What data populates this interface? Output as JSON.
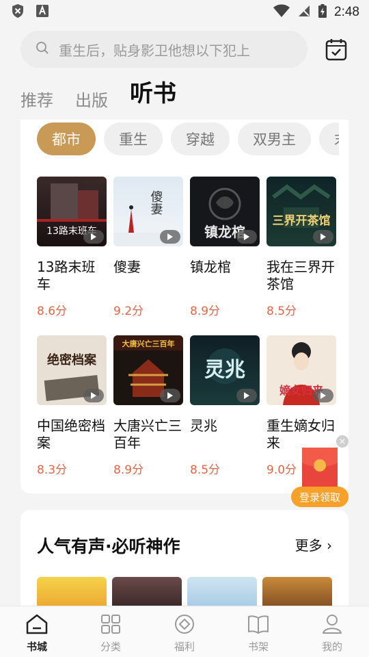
{
  "status_bar": {
    "time": "2:48"
  },
  "search": {
    "placeholder": "重生后，贴身影卫他想以下犯上"
  },
  "tabs": [
    {
      "label": "推荐",
      "active": false
    },
    {
      "label": "出版",
      "active": false
    },
    {
      "label": "听书",
      "active": true
    }
  ],
  "categories": [
    "都市",
    "重生",
    "穿越",
    "双男主",
    "末"
  ],
  "selected_category": "都市",
  "books": [
    {
      "title": "13路末班车",
      "score": "8.6分",
      "cover_text": "13路末班车"
    },
    {
      "title": "傻妻",
      "score": "9.2分",
      "cover_text": "傻妻"
    },
    {
      "title": "镇龙棺",
      "score": "8.9分",
      "cover_text": "镇龙棺"
    },
    {
      "title": "我在三界开茶馆",
      "score": "8.5分",
      "cover_text": "三界开茶馆"
    },
    {
      "title": "中国绝密档案",
      "score": "8.3分",
      "cover_text": "绝密档案"
    },
    {
      "title": "大唐兴亡三百年",
      "score": "8.9分",
      "cover_text": "大唐兴亡三百年"
    },
    {
      "title": "灵兆",
      "score": "8.5分",
      "cover_text": "灵兆"
    },
    {
      "title": "重生嫡女归来",
      "score": "9.0分",
      "cover_text": "嫡女归来"
    }
  ],
  "promo": {
    "claim_label": "登录领取",
    "close": "×"
  },
  "section": {
    "title": "人气有声·必听神作",
    "more": "更多 ›"
  },
  "bottom_nav": [
    {
      "label": "书城",
      "icon": "bookstore-icon",
      "active": true
    },
    {
      "label": "分类",
      "icon": "category-grid-icon",
      "active": false
    },
    {
      "label": "福利",
      "icon": "welfare-icon",
      "active": false
    },
    {
      "label": "书架",
      "icon": "bookshelf-icon",
      "active": false
    },
    {
      "label": "我的",
      "icon": "profile-icon",
      "active": false
    }
  ],
  "colors": {
    "accent": "#c99a55",
    "score": "#e0664a",
    "claim": "#f7a02a",
    "envelope": "#e8453c"
  }
}
